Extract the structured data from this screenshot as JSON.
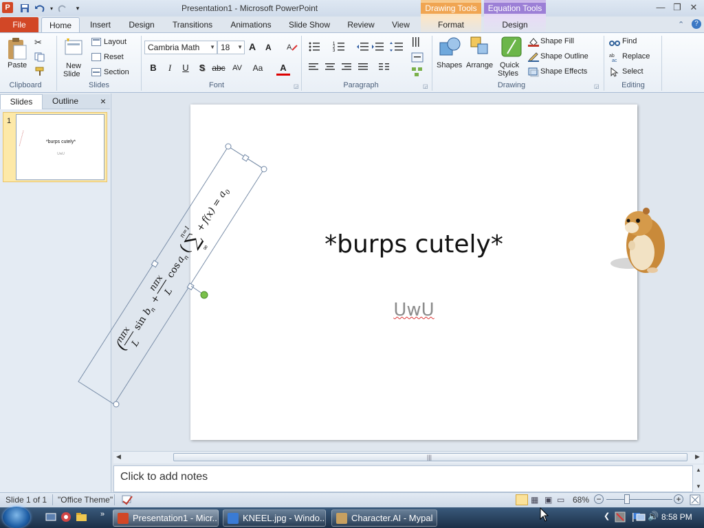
{
  "window": {
    "title": "Presentation1  -  Microsoft PowerPoint",
    "app_icon": "P",
    "context_tabs": {
      "drawing": "Drawing Tools",
      "equation": "Equation Tools"
    }
  },
  "tabs": {
    "file": "File",
    "items": [
      "Home",
      "Insert",
      "Design",
      "Transitions",
      "Animations",
      "Slide Show",
      "Review",
      "View"
    ],
    "format": "Format",
    "design2": "Design"
  },
  "ribbon": {
    "clipboard": {
      "label": "Clipboard",
      "paste": "Paste"
    },
    "slides": {
      "label": "Slides",
      "new_slide_1": "New",
      "new_slide_2": "Slide",
      "layout": "Layout",
      "reset": "Reset",
      "section": "Section"
    },
    "font": {
      "label": "Font",
      "family": "Cambria Math",
      "size": "18",
      "grow": "A",
      "shrink": "A",
      "bold": "B",
      "italic": "I",
      "underline": "U",
      "shadow": "S",
      "strike": "abc",
      "spacing": "AV",
      "case": "Aa",
      "color": "A"
    },
    "paragraph": {
      "label": "Paragraph"
    },
    "drawing": {
      "label": "Drawing",
      "shapes": "Shapes",
      "arrange": "Arrange",
      "quick_styles_1": "Quick",
      "quick_styles_2": "Styles",
      "shape_fill": "Shape Fill",
      "shape_outline": "Shape Outline",
      "shape_effects": "Shape Effects"
    },
    "editing": {
      "label": "Editing",
      "find": "Find",
      "replace": "Replace",
      "select": "Select"
    }
  },
  "left_panel": {
    "tab_slides": "Slides",
    "tab_outline": "Outline",
    "close": "×",
    "thumb_number": "1",
    "thumb_title": "*burps cutely*",
    "thumb_subtitle": "UwU"
  },
  "slide": {
    "title": "*burps cutely*",
    "subtitle": "UwU",
    "equation": {
      "lhs": "f(x) = a",
      "lhs_sub": "0",
      "plus": "+",
      "sum_top": "∞",
      "sum_bottom": "n=1",
      "open": "(",
      "a_n": "a",
      "n_sub": "n",
      "cos": "cos",
      "frac1_num": "nπx",
      "frac1_den": "L",
      "plus2": "+",
      "b_n": "b",
      "sin": "sin",
      "frac2_num": "nπx",
      "frac2_den": "L",
      "close": ")"
    }
  },
  "notes": {
    "placeholder": "Click to add notes"
  },
  "status": {
    "slide_of": "Slide 1 of 1",
    "theme": "\"Office Theme\"",
    "zoom": "68%",
    "zoom_minus": "−",
    "zoom_plus": "+"
  },
  "taskbar": {
    "items": [
      "Presentation1 - Micr...",
      "KNEEL.jpg - Windo...",
      "Character.AI - Mypal"
    ],
    "time": "8:58 PM"
  },
  "colors": {
    "file_tab": "#d24726",
    "drawing_tools": "#f0a552",
    "equation_tools": "#9c7fd6",
    "selection_handle": "#7ac04a"
  }
}
